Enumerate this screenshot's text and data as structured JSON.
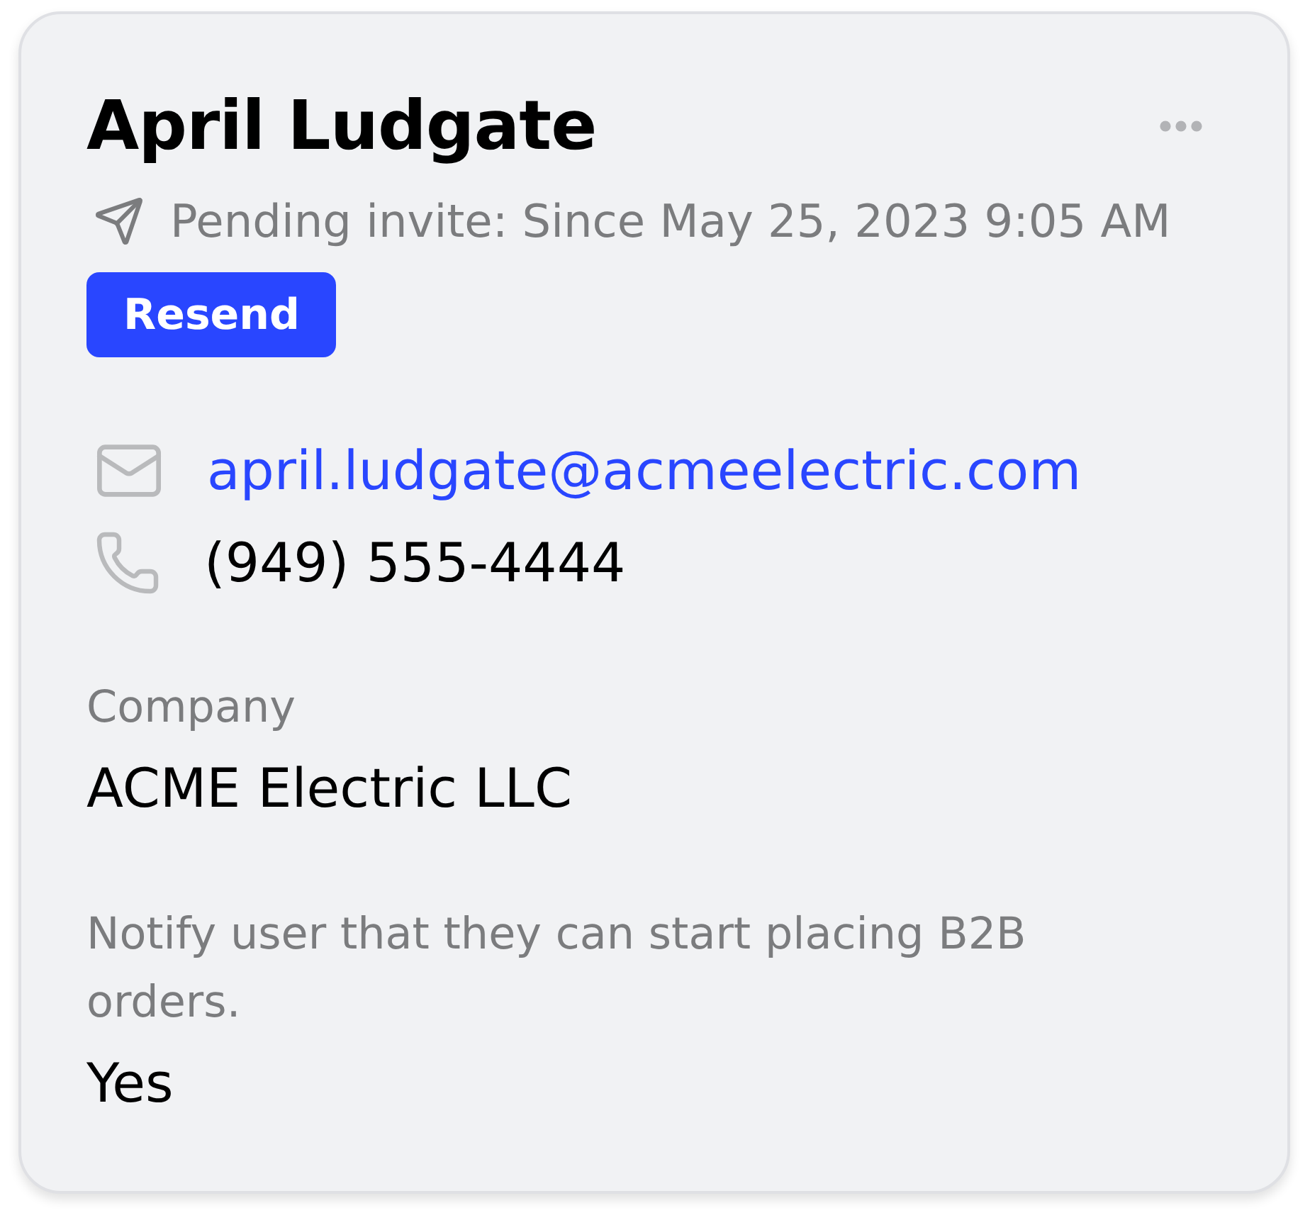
{
  "contact": {
    "name": "April Ludgate",
    "status": "Pending invite: Since May 25, 2023 9:05 AM",
    "resend_button": "Resend"
  },
  "channels": [
    {
      "kind": "email",
      "text": "april.ludgate@acmeelectric.com"
    },
    {
      "kind": "phone",
      "text": "(949) 555-4444"
    }
  ],
  "fields": [
    {
      "label": "Company",
      "value": "ACME Electric LLC"
    },
    {
      "label": "Notify user that they can start placing B2B orders.",
      "value": "Yes"
    }
  ]
}
